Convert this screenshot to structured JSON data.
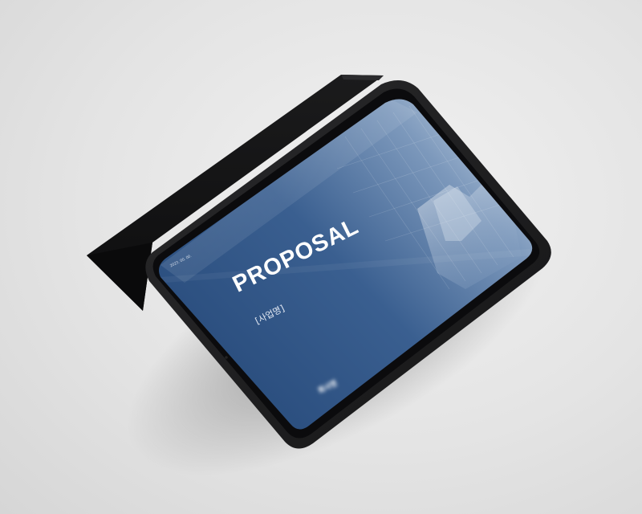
{
  "screen": {
    "title": "PROPOSAL",
    "subtitle": "[사업명]",
    "date": "2023. 00. 00.",
    "company": "회사명",
    "company_sub": "",
    "copyright": ""
  },
  "colors": {
    "background": "#e6e6e6",
    "case": "#1d1d1f",
    "bezel": "#0e0e10",
    "screen_blue": "#2c4f7f",
    "text": "#ffffff"
  }
}
